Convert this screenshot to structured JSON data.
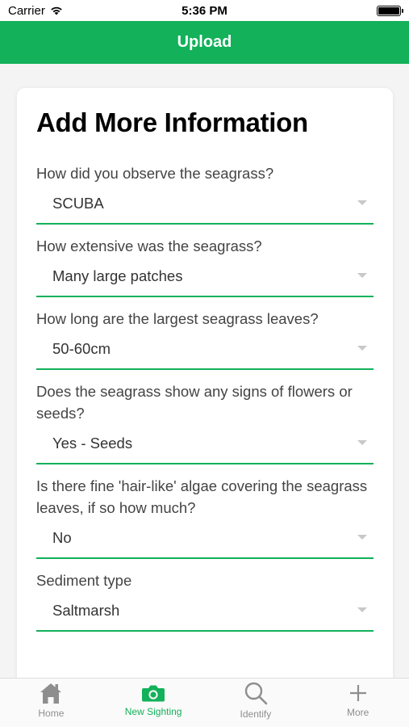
{
  "status": {
    "carrier": "Carrier",
    "time": "5:36 PM"
  },
  "nav": {
    "title": "Upload"
  },
  "card": {
    "title": "Add More Information"
  },
  "fields": [
    {
      "question": "How did you observe the seagrass?",
      "value": "SCUBA"
    },
    {
      "question": "How extensive was the seagrass?",
      "value": "Many large patches"
    },
    {
      "question": "How long are the largest seagrass leaves?",
      "value": "50-60cm"
    },
    {
      "question": "Does the seagrass show any signs of flowers or seeds?",
      "value": "Yes - Seeds"
    },
    {
      "question": "Is there fine 'hair-like' algae covering the seagrass leaves, if so how much?",
      "value": "No"
    },
    {
      "question": "Sediment type",
      "value": "Saltmarsh"
    }
  ],
  "tabs": [
    {
      "label": "Home",
      "icon": "home-icon"
    },
    {
      "label": "New Sighting",
      "icon": "camera-icon",
      "active": true
    },
    {
      "label": "Identify",
      "icon": "search-icon"
    },
    {
      "label": "More",
      "icon": "plus-icon"
    }
  ],
  "colors": {
    "accent": "#12b15a",
    "inactive": "#8e8e8e"
  }
}
